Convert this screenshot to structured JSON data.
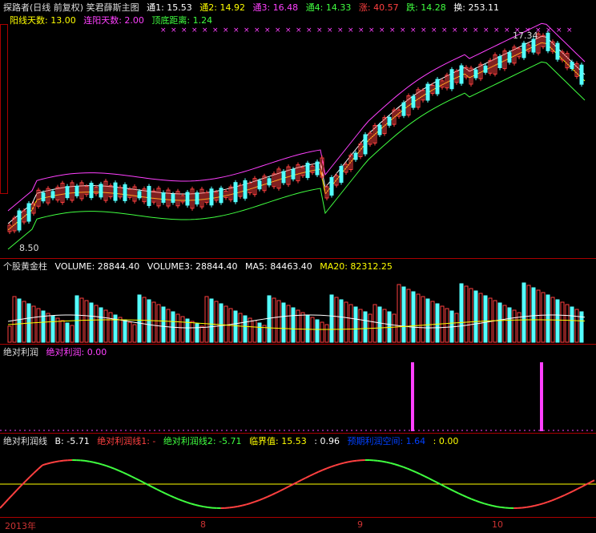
{
  "main": {
    "header1": [
      "探路者(日线 前复权) 笑君薛斯主图",
      "通1: 15.53",
      "通2: 14.92",
      "通3: 16.48",
      "通4: 14.33",
      "涨: 40.57",
      "跌: 14.28",
      "换: 253.11"
    ],
    "header2": [
      "阳线天数: 13.00",
      "连阳天数: 2.00",
      "顶底距离: 1.24"
    ],
    "high_label": "17.34",
    "low_label": "8.50"
  },
  "volume": {
    "header": [
      "个股黄金柱",
      "VOLUME: 28844.40",
      "VOLUME3: 28844.40",
      "MA5: 84463.40",
      "MA20: 82312.25"
    ]
  },
  "profit": {
    "header": [
      "绝对利润",
      "绝对利润: 0.00"
    ]
  },
  "profitline": {
    "header": [
      "绝对利润线",
      "B: -5.71",
      "绝对利润线1: -",
      "绝对利润线2: -5.71",
      "临界值: 15.53",
      ": 0.96",
      "预期利润空间: 1.64",
      ": 0.00"
    ]
  },
  "xaxis": {
    "labels": [
      "2013年",
      "8",
      "9",
      "10"
    ]
  },
  "colors": {
    "up": "#ff4040",
    "down": "#54ffff",
    "ma1": "#ffffff",
    "ma2": "#ffff00",
    "ma3": "#ff40ff",
    "ma4": "#40ff40",
    "sep": "#aa0000"
  }
}
